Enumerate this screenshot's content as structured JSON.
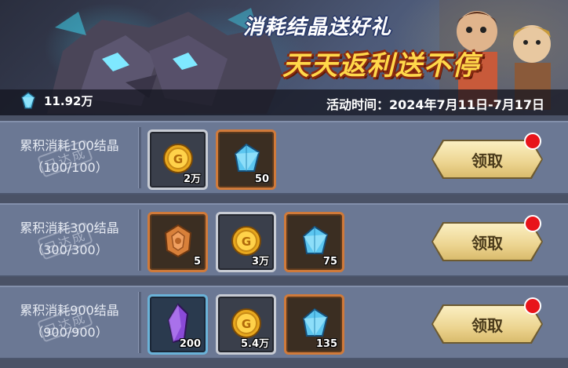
{
  "banner": {
    "title_line1": "消耗结晶送好礼",
    "title_line2": "天天返利送不停",
    "crystal_count": "11.92万",
    "event_time": "活动时间：2024年7月11日-7月17日"
  },
  "tiers": [
    {
      "desc": "累积消耗100结晶",
      "progress": "（100/100）",
      "stamp": "已达成",
      "claim_label": "领取",
      "rewards": [
        {
          "icon": "gold-coin-icon",
          "frame": "grey",
          "qty": "2万"
        },
        {
          "icon": "blue-crystal-icon",
          "frame": "orange",
          "qty": "50"
        }
      ]
    },
    {
      "desc": "累积消耗300结晶",
      "progress": "（300/300）",
      "stamp": "已达成",
      "claim_label": "领取",
      "rewards": [
        {
          "icon": "bronze-medal-icon",
          "frame": "orange",
          "qty": "5"
        },
        {
          "icon": "gold-coin-icon",
          "frame": "grey",
          "qty": "3万"
        },
        {
          "icon": "blue-crystal-icon",
          "frame": "orange",
          "qty": "75"
        }
      ]
    },
    {
      "desc": "累积消耗900结晶",
      "progress": "（900/900）",
      "stamp": "已达成",
      "claim_label": "领取",
      "rewards": [
        {
          "icon": "purple-crystal-icon",
          "frame": "blue",
          "qty": "200"
        },
        {
          "icon": "gold-coin-icon",
          "frame": "grey",
          "qty": "5.4万"
        },
        {
          "icon": "blue-crystal-icon",
          "frame": "orange",
          "qty": "135"
        }
      ]
    }
  ],
  "colors": {
    "background": "#4a5266",
    "row": "#6b7894",
    "title_yellow": "#ffd84a",
    "notify_red": "#e8141a"
  }
}
